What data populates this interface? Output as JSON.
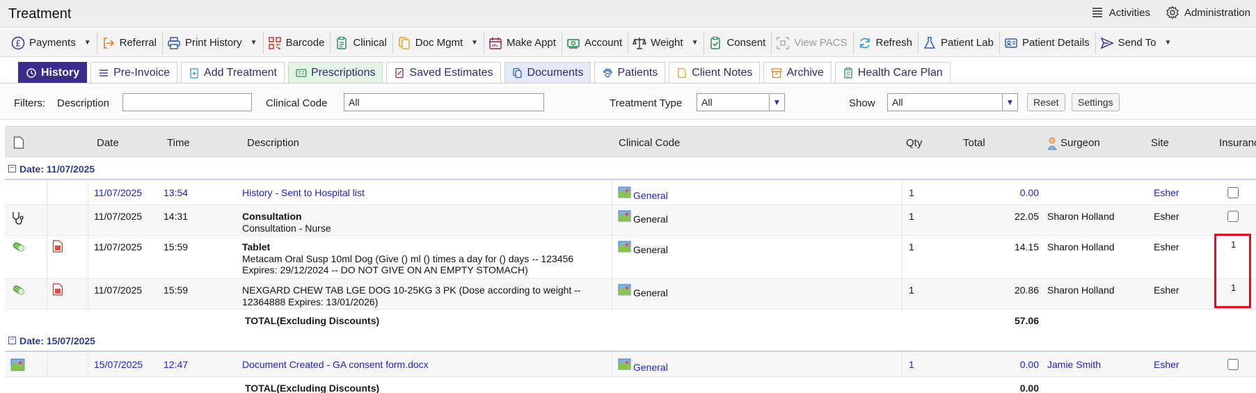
{
  "window": {
    "title": "Treatment"
  },
  "title_actions": [
    {
      "label": "Activities",
      "icon": "list-icon"
    },
    {
      "label": "Administration",
      "icon": "gear-icon"
    }
  ],
  "toolbar": [
    {
      "label": "Payments",
      "icon": "pound-icon",
      "dropdown": true,
      "disabled": false
    },
    {
      "label": "Referral",
      "icon": "referral-icon",
      "dropdown": false,
      "disabled": false
    },
    {
      "label": "Print History",
      "icon": "printer-icon",
      "dropdown": true,
      "disabled": false
    },
    {
      "label": "Barcode",
      "icon": "barcode-icon",
      "dropdown": false,
      "disabled": false
    },
    {
      "label": "Clinical",
      "icon": "clipboard-icon",
      "dropdown": false,
      "disabled": false
    },
    {
      "label": "Doc Mgmt",
      "icon": "documents-icon",
      "dropdown": true,
      "disabled": false
    },
    {
      "label": "Make Appt",
      "icon": "calendar-icon",
      "dropdown": false,
      "disabled": false
    },
    {
      "label": "Account",
      "icon": "money-icon",
      "dropdown": false,
      "disabled": false
    },
    {
      "label": "Weight",
      "icon": "scales-icon",
      "dropdown": true,
      "disabled": false
    },
    {
      "label": "Consent",
      "icon": "consent-icon",
      "dropdown": false,
      "disabled": false
    },
    {
      "label": "View PACS",
      "icon": "pacs-icon",
      "dropdown": false,
      "disabled": true
    },
    {
      "label": "Refresh",
      "icon": "refresh-icon",
      "dropdown": false,
      "disabled": false
    },
    {
      "label": "Patient Lab",
      "icon": "flask-icon",
      "dropdown": false,
      "disabled": false
    },
    {
      "label": "Patient Details",
      "icon": "id-card-icon",
      "dropdown": false,
      "disabled": false
    },
    {
      "label": "Send To",
      "icon": "send-icon",
      "dropdown": true,
      "disabled": false
    }
  ],
  "tabs": [
    {
      "label": "History",
      "icon": "history-icon",
      "active": true
    },
    {
      "label": "Pre-Invoice",
      "icon": "lines-icon",
      "active": false
    },
    {
      "label": "Add Treatment",
      "icon": "add-clipboard-icon",
      "active": false
    },
    {
      "label": "Prescriptions",
      "icon": "prescription-icon",
      "active": false
    },
    {
      "label": "Saved Estimates",
      "icon": "estimate-icon",
      "active": false
    },
    {
      "label": "Documents",
      "icon": "documents-icon",
      "active": false
    },
    {
      "label": "Patients",
      "icon": "paw-icon",
      "active": false
    },
    {
      "label": "Client Notes",
      "icon": "note-icon",
      "active": false
    },
    {
      "label": "Archive",
      "icon": "archive-icon",
      "active": false
    },
    {
      "label": "Health Care Plan",
      "icon": "plan-icon",
      "active": false
    }
  ],
  "filters": {
    "label": "Filters:",
    "description_label": "Description",
    "description_value": "",
    "clinical_code_label": "Clinical Code",
    "clinical_code_value": "All",
    "treatment_type_label": "Treatment Type",
    "treatment_type_value": "All",
    "show_label": "Show",
    "show_value": "All",
    "reset_label": "Reset",
    "settings_label": "Settings"
  },
  "columns": {
    "date": "Date",
    "time": "Time",
    "description": "Description",
    "clinical_code": "Clinical Code",
    "qty": "Qty",
    "total": "Total",
    "surgeon": "Surgeon",
    "site": "Site",
    "insurance": "Insuranc"
  },
  "groups": [
    {
      "label": "Date: 11/07/2025",
      "rows": [
        {
          "icon1": "",
          "icon2": "",
          "date": "11/07/2025",
          "time": "13:54",
          "title": "",
          "description": "History - Sent to Hospital list",
          "code": "General",
          "qty": "1",
          "total": "0.00",
          "surgeon": "",
          "site": "Esher",
          "insurance": "",
          "checkbox": true,
          "link": true
        },
        {
          "icon1": "stethoscope-icon",
          "icon2": "",
          "date": "11/07/2025",
          "time": "14:31",
          "title": "Consultation",
          "description": "Consultation - Nurse",
          "code": "General",
          "qty": "1",
          "total": "22.05",
          "surgeon": "Sharon Holland",
          "site": "Esher",
          "insurance": "",
          "checkbox": true,
          "link": false
        },
        {
          "icon1": "pill-icon",
          "icon2": "document-red-icon",
          "date": "11/07/2025",
          "time": "15:59",
          "title": "Tablet",
          "description": "Metacam Oral Susp 10ml Dog (Give () ml () times a day for () days -- 123456 Expires: 29/12/2024 -- DO NOT GIVE ON AN EMPTY STOMACH)",
          "code": "General",
          "qty": "1",
          "total": "14.15",
          "surgeon": "Sharon Holland",
          "site": "Esher",
          "insurance": "1",
          "checkbox": false,
          "link": false
        },
        {
          "icon1": "pill-icon",
          "icon2": "document-red-icon",
          "date": "11/07/2025",
          "time": "15:59",
          "title": "",
          "description": "NEXGARD CHEW TAB LGE DOG 10-25KG 3 PK (Dose according to weight -- 12364888 Expires: 13/01/2026)",
          "code": "General",
          "qty": "1",
          "total": "20.86",
          "surgeon": "Sharon Holland",
          "site": "Esher",
          "insurance": "1",
          "checkbox": false,
          "link": false
        }
      ],
      "total_label": "TOTAL(Excluding Discounts)",
      "total_value": "57.06"
    },
    {
      "label": "Date: 15/07/2025",
      "rows": [
        {
          "icon1": "map-icon",
          "icon2": "",
          "date": "15/07/2025",
          "time": "12:47",
          "title": "",
          "description": "Document Created - GA consent form.docx",
          "code": "General",
          "qty": "1",
          "total": "0.00",
          "surgeon": "Jamie Smith",
          "site": "Esher",
          "insurance": "",
          "checkbox": true,
          "link": true
        }
      ],
      "total_label": "TOTAL(Excluding Discounts)",
      "total_value": "0.00"
    }
  ],
  "colors": {
    "active_tab": "#3a2d8c",
    "link": "#2020c8",
    "group_label": "#2d3a90",
    "highlight": "#e0101e"
  }
}
